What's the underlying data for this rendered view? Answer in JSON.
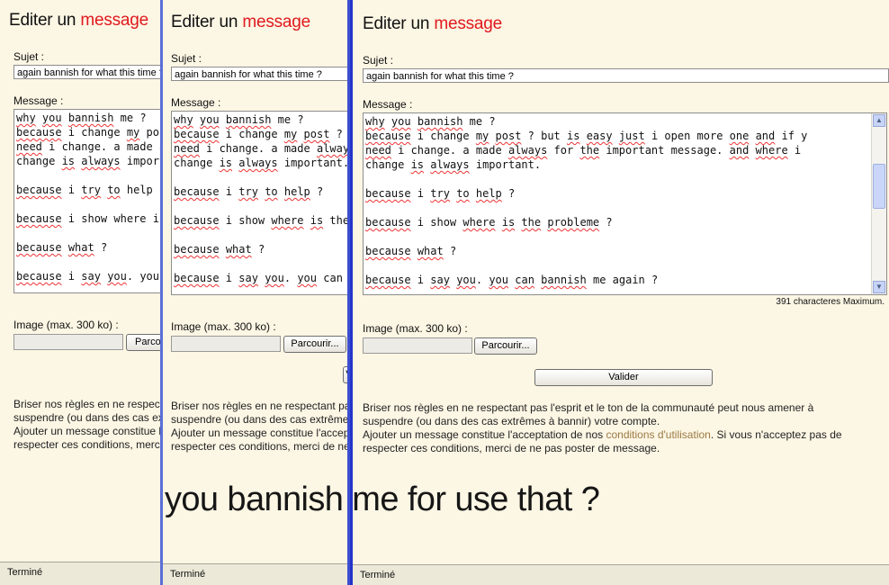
{
  "page": {
    "title_prefix": "Editer un ",
    "title_accent": "message",
    "subject_label": "Sujet :",
    "subject_value": "again bannish for what this time ?",
    "message_label": "Message :",
    "message_lines": [
      "why you bannish me ?",
      "because i change my post ? but is easy just i open more one and if y",
      "need i change. a made always for the important message. and where i",
      "change is always important.",
      "",
      "because i try to help ?",
      "",
      "because i show where is the probleme ?",
      "",
      "because what ?",
      "",
      "because i say you. you can bannish me again ?"
    ],
    "char_limit_text": "391 characteres Maximum.",
    "image_label": "Image (max. 300 ko) :",
    "browse_label": "Parcourir...",
    "submit_label": "Valider",
    "rules_line1": "Briser nos règles en ne respectant pas l'esprit et le ton de la communauté peut nous amener à",
    "rules_line2": "suspendre (ou dans des cas extrêmes à bannir) votre compte.",
    "rules_line3_pre": "Ajouter un message constitue l'acceptation de nos ",
    "rules_link": "conditions d'utilisation",
    "rules_line3_post": ". Si vous n'acceptez pas de",
    "rules_line4": "respecter ces conditions, merci de ne pas poster de message.",
    "status": "Terminé"
  },
  "caption": "you bannish me for use that ?",
  "colors": {
    "accent": "#e0191e",
    "page_bg": "#fcf6e4",
    "link": "#9c7a45",
    "window_border": "#3c4fd0"
  },
  "icons": {
    "scroll_up": "▲",
    "scroll_down": "▼"
  }
}
